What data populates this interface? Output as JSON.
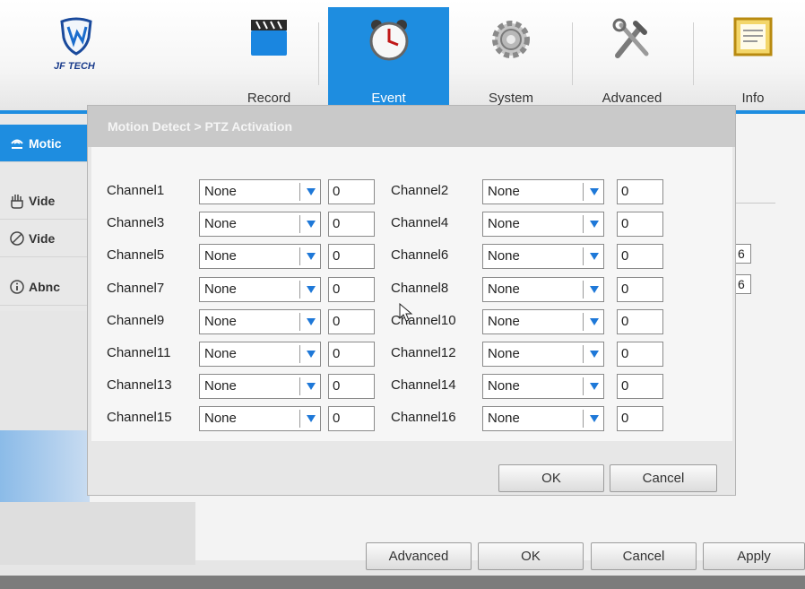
{
  "nav": {
    "logo_text": "JF TECH",
    "items": [
      {
        "label": "Record",
        "icon": "clapperboard-icon"
      },
      {
        "label": "Event",
        "icon": "alarm-clock-icon",
        "active": true
      },
      {
        "label": "System",
        "icon": "gear-icon"
      },
      {
        "label": "Advanced",
        "icon": "tools-icon"
      },
      {
        "label": "Info",
        "icon": "document-icon"
      }
    ]
  },
  "sidebar": {
    "items": [
      {
        "label": "Motic",
        "icon": "motion-icon",
        "active": true
      },
      {
        "label": "Vide",
        "icon": "hand-icon"
      },
      {
        "label": "Vide",
        "icon": "no-signal-icon"
      },
      {
        "label": "Abnc",
        "icon": "info-icon"
      }
    ]
  },
  "background": {
    "field1": "6",
    "field2": "6",
    "buttons": {
      "advanced": "Advanced",
      "ok": "OK",
      "cancel": "Cancel",
      "apply": "Apply"
    }
  },
  "dialog": {
    "title": "Motion Detect > PTZ Activation",
    "channels": [
      {
        "label": "Channel1",
        "mode": "None",
        "value": "0"
      },
      {
        "label": "Channel2",
        "mode": "None",
        "value": "0"
      },
      {
        "label": "Channel3",
        "mode": "None",
        "value": "0"
      },
      {
        "label": "Channel4",
        "mode": "None",
        "value": "0"
      },
      {
        "label": "Channel5",
        "mode": "None",
        "value": "0"
      },
      {
        "label": "Channel6",
        "mode": "None",
        "value": "0"
      },
      {
        "label": "Channel7",
        "mode": "None",
        "value": "0"
      },
      {
        "label": "Channel8",
        "mode": "None",
        "value": "0"
      },
      {
        "label": "Channel9",
        "mode": "None",
        "value": "0"
      },
      {
        "label": "Channel10",
        "mode": "None",
        "value": "0"
      },
      {
        "label": "Channel11",
        "mode": "None",
        "value": "0"
      },
      {
        "label": "Channel12",
        "mode": "None",
        "value": "0"
      },
      {
        "label": "Channel13",
        "mode": "None",
        "value": "0"
      },
      {
        "label": "Channel14",
        "mode": "None",
        "value": "0"
      },
      {
        "label": "Channel15",
        "mode": "None",
        "value": "0"
      },
      {
        "label": "Channel16",
        "mode": "None",
        "value": "0"
      }
    ],
    "ok_label": "OK",
    "cancel_label": "Cancel"
  },
  "colors": {
    "accent": "#1e8de0",
    "dropdown_arrow": "#1e78d8"
  }
}
